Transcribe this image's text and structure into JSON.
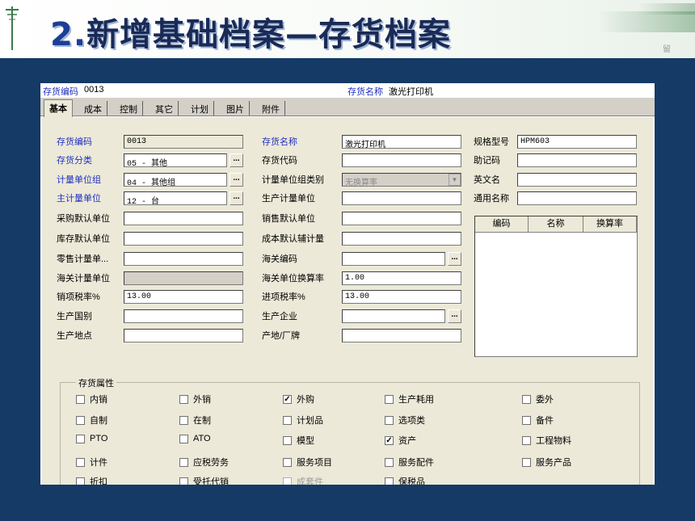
{
  "slide": {
    "title_num": "2.",
    "title_text": "新增基础档案—存货档案",
    "logo": "留"
  },
  "topbar": {
    "code_label": "存货编码",
    "code_value": "0013",
    "name_label": "存货名称",
    "name_value": "激光打印机"
  },
  "tabs": [
    "基本",
    "成本",
    "控制",
    "其它",
    "计划",
    "图片",
    "附件"
  ],
  "left_fields": [
    {
      "label": "存货编码",
      "value": "0013"
    },
    {
      "label": "存货分类",
      "value": "05 - 其他"
    },
    {
      "label": "计量单位组",
      "value": "04 - 其他组"
    },
    {
      "label": "主计量单位",
      "value": "12 - 台"
    },
    {
      "label": "采购默认单位",
      "value": ""
    },
    {
      "label": "库存默认单位",
      "value": ""
    },
    {
      "label": "零售计量单...",
      "value": ""
    },
    {
      "label": "海关计量单位",
      "value": ""
    },
    {
      "label": "销项税率%",
      "value": "13.00"
    },
    {
      "label": "生产国别",
      "value": ""
    },
    {
      "label": "生产地点",
      "value": ""
    }
  ],
  "mid_fields": [
    {
      "label": "存货名称",
      "value": "激光打印机"
    },
    {
      "label": "存货代码",
      "value": ""
    },
    {
      "label": "计量单位组类别",
      "value": "无换算率"
    },
    {
      "label": "生产计量单位",
      "value": ""
    },
    {
      "label": "销售默认单位",
      "value": ""
    },
    {
      "label": "成本默认辅计量",
      "value": ""
    },
    {
      "label": "海关编码",
      "value": ""
    },
    {
      "label": "海关单位换算率",
      "value": "1.00"
    },
    {
      "label": "进项税率%",
      "value": "13.00"
    },
    {
      "label": "生产企业",
      "value": ""
    },
    {
      "label": "产地/厂牌",
      "value": ""
    }
  ],
  "right_fields": [
    {
      "label": "规格型号",
      "value": "HPM603"
    },
    {
      "label": "助记码",
      "value": ""
    },
    {
      "label": "英文名",
      "value": ""
    },
    {
      "label": "通用名称",
      "value": ""
    }
  ],
  "grid_headers": [
    "编码",
    "名称",
    "换算率"
  ],
  "ellipsis": "...",
  "dropdown_arrow": "▼",
  "attributes_title": "存货属性",
  "attributes": [
    {
      "label": "内销",
      "checked": false
    },
    {
      "label": "外销",
      "checked": false
    },
    {
      "label": "外购",
      "checked": true
    },
    {
      "label": "生产耗用",
      "checked": false
    },
    {
      "label": "委外",
      "checked": false
    },
    {
      "label": "自制",
      "checked": false
    },
    {
      "label": "在制",
      "checked": false
    },
    {
      "label": "计划品",
      "checked": false
    },
    {
      "label": "选项类",
      "checked": false
    },
    {
      "label": "备件",
      "checked": false
    },
    {
      "label": "PTO",
      "checked": false
    },
    {
      "label": "ATO",
      "checked": false
    },
    {
      "label": "模型",
      "checked": false
    },
    {
      "label": "资产",
      "checked": true
    },
    {
      "label": "工程物料",
      "checked": false
    },
    {
      "label": "计件",
      "checked": false
    },
    {
      "label": "应税劳务",
      "checked": false
    },
    {
      "label": "服务项目",
      "checked": false
    },
    {
      "label": "服务配件",
      "checked": false
    },
    {
      "label": "服务产品",
      "checked": false
    },
    {
      "label": "折扣",
      "checked": false
    },
    {
      "label": "受托代销",
      "checked": false
    },
    {
      "label": "成套件",
      "checked": false
    },
    {
      "label": "保税品",
      "checked": false
    }
  ],
  "check_mark": "✓"
}
